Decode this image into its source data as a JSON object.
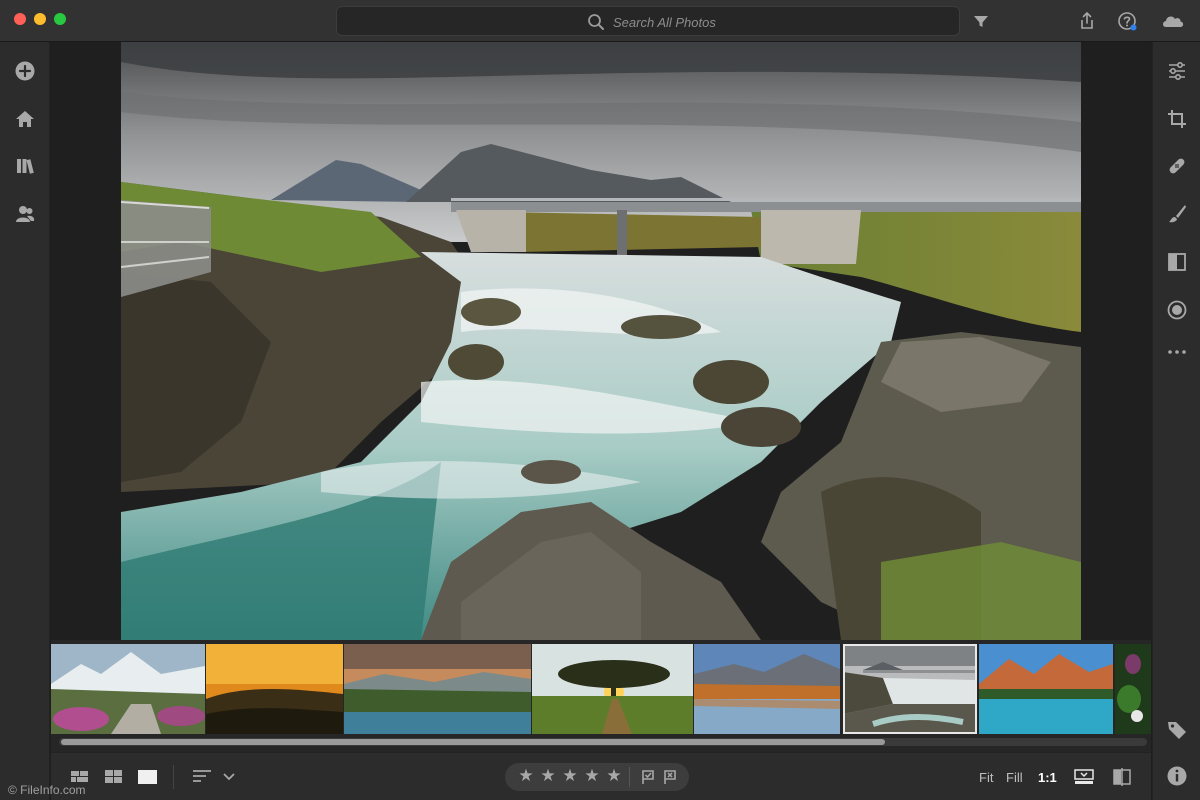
{
  "window": {
    "traffic_lights": {
      "close": "#fe5f57",
      "minimize": "#febc2e",
      "zoom": "#28c840"
    }
  },
  "search": {
    "placeholder": "Search All Photos"
  },
  "toolbar_icons": [
    "filter-icon",
    "share-icon",
    "help-icon",
    "cloud-icon"
  ],
  "left_rail": [
    "add-photos-icon",
    "home-icon",
    "library-icon",
    "people-icon"
  ],
  "right_rail": [
    "edit-sliders-icon",
    "crop-icon",
    "healing-icon",
    "brush-icon",
    "linear-gradient-icon",
    "radial-gradient-icon",
    "more-icon",
    "keyword-tag-icon",
    "info-icon"
  ],
  "filmstrip": {
    "thumbnails": [
      "mountain-path",
      "sunset-hills",
      "lake-forest",
      "tree-sunset",
      "autumn-lake",
      "river-bridge",
      "mountain-lake",
      "flowers"
    ],
    "selected_index": 5,
    "scroll_position": 0.76
  },
  "bottom_bar": {
    "view_icons": [
      "grid-small-icon",
      "grid-large-icon",
      "single-view-icon",
      "sort-icon",
      "chevron-down-icon"
    ],
    "rating_stars": [
      "★",
      "★",
      "★",
      "★",
      "★"
    ],
    "flag_icons": [
      "pick-flag-icon",
      "reject-flag-icon"
    ],
    "zoom": {
      "fit": "Fit",
      "fill": "Fill",
      "one_to_one": "1:1"
    },
    "active_zoom": "1:1"
  },
  "watermark": "© FileInfo.com",
  "colors": {
    "background": "#1e1e1e",
    "panel": "#2c2c2c",
    "icon": "#a8a8a8"
  }
}
